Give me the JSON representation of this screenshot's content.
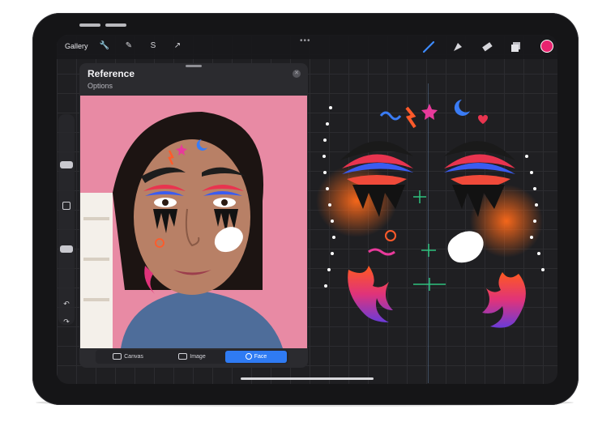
{
  "toolbar": {
    "gallery_label": "Gallery",
    "left_tools": [
      "wrench-icon",
      "magic-wand-icon",
      "selection-icon",
      "transform-arrow-icon"
    ],
    "more_label": "•••",
    "right_tools": [
      "brush-icon",
      "smudge-icon",
      "eraser-icon",
      "layers-icon"
    ],
    "current_color": "#e8236f"
  },
  "reference": {
    "title": "Reference",
    "options_label": "Options",
    "close_label": "✕",
    "tabs": [
      {
        "label": "Canvas",
        "active": false,
        "icon": "canvas-icon"
      },
      {
        "label": "Image",
        "active": false,
        "icon": "image-icon"
      },
      {
        "label": "Face",
        "active": true,
        "icon": "face-icon"
      }
    ]
  },
  "sidebar": {
    "undo_label": "↶",
    "redo_label": "↷"
  },
  "colors": {
    "accent": "#2f7bf3",
    "canvas_bg": "#1f1f22",
    "device": "#151517"
  }
}
